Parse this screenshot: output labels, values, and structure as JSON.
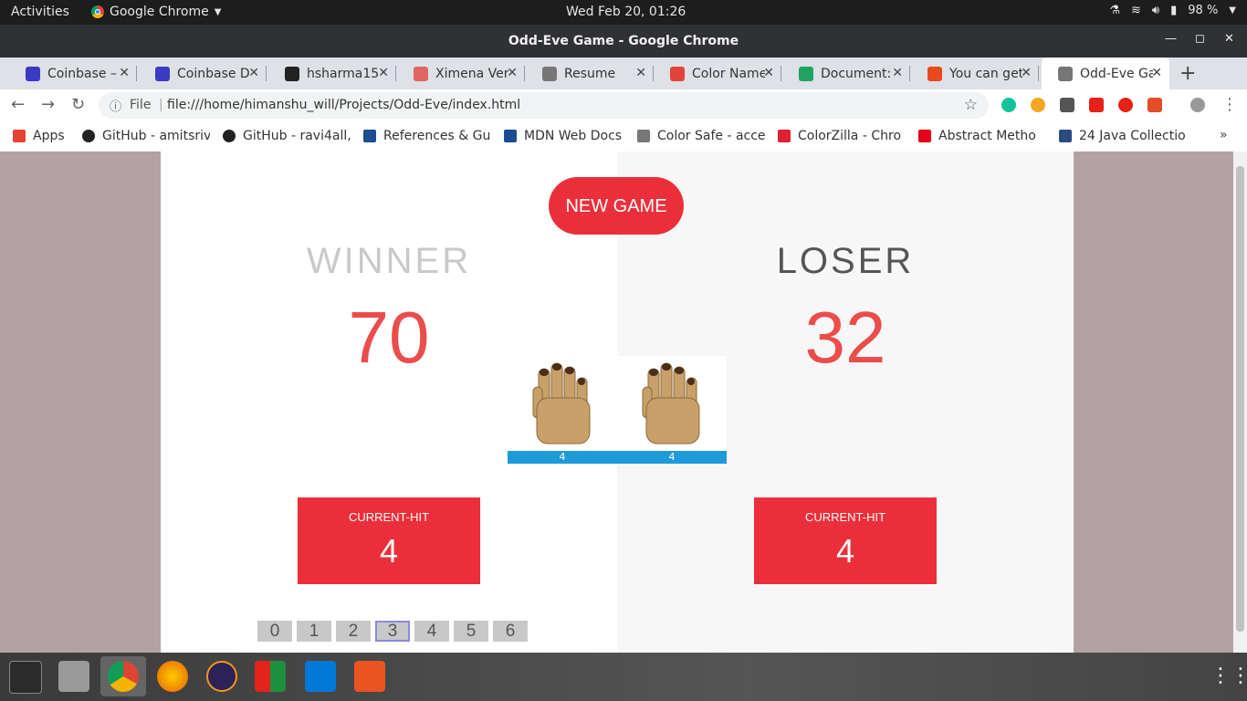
{
  "system_bar": {
    "activities": "Activities",
    "app_name": "Google Chrome",
    "clock": "Wed Feb 20, 01:26",
    "battery": "98 %"
  },
  "window": {
    "title": "Odd-Eve Game - Google Chrome"
  },
  "tabs": [
    {
      "label": "Coinbase –",
      "icon": "coinbase-icon",
      "color": "#3b3ac4",
      "active": false
    },
    {
      "label": "Coinbase D",
      "icon": "coinbase-icon",
      "color": "#3b3ac4",
      "active": false
    },
    {
      "label": "hsharma15",
      "icon": "github-icon",
      "color": "#222222",
      "active": false
    },
    {
      "label": "Ximena Ver",
      "icon": "slides-icon",
      "color": "#e06666",
      "active": false
    },
    {
      "label": "Resume",
      "icon": "document-icon",
      "color": "#777777",
      "active": false
    },
    {
      "label": "Color Name",
      "icon": "color-icon",
      "color": "#e2443a",
      "active": false
    },
    {
      "label": "Document:",
      "icon": "drive-icon",
      "color": "#1fa463",
      "active": false
    },
    {
      "label": "You can get",
      "icon": "asterisk-icon",
      "color": "#e8491d",
      "active": false
    },
    {
      "label": "Odd-Eve Ga",
      "icon": "document-icon",
      "color": "#777777",
      "active": true
    }
  ],
  "address_bar": {
    "scheme_label": "File",
    "url": "file:///home/himanshu_will/Projects/Odd-Eve/index.html"
  },
  "bookmarks": [
    {
      "label": "Apps",
      "icon": "apps-grid-icon"
    },
    {
      "label": "GitHub - amitsriv",
      "icon": "github-icon"
    },
    {
      "label": "GitHub - ravi4all,",
      "icon": "github-icon"
    },
    {
      "label": "References & Gu",
      "icon": "mdn-icon"
    },
    {
      "label": "MDN Web Docs",
      "icon": "mdn-icon"
    },
    {
      "label": "Color Safe - acce",
      "icon": "document-icon"
    },
    {
      "label": "ColorZilla - Chro",
      "icon": "colorzilla-icon"
    },
    {
      "label": "Abstract Metho",
      "icon": "oracle-icon"
    },
    {
      "label": "24 Java Collectio",
      "icon": "dzone-icon"
    }
  ],
  "game": {
    "new_game_label": "NEW GAME",
    "winner": {
      "label": "WINNER",
      "score": "70",
      "current_label": "CURRENT-HIT",
      "current_value": "4",
      "hand_number": "4"
    },
    "loser": {
      "label": "LOSER",
      "score": "32",
      "current_label": "CURRENT-HIT",
      "current_value": "4",
      "hand_number": "4"
    },
    "number_buttons": [
      "0",
      "1",
      "2",
      "3",
      "4",
      "5",
      "6"
    ],
    "selected_number": "3"
  },
  "colors": {
    "accent_red": "#eb2f3a",
    "score_red": "#eb4d4b",
    "winner_gray": "#c9c9c9",
    "loser_dark": "#555555"
  }
}
